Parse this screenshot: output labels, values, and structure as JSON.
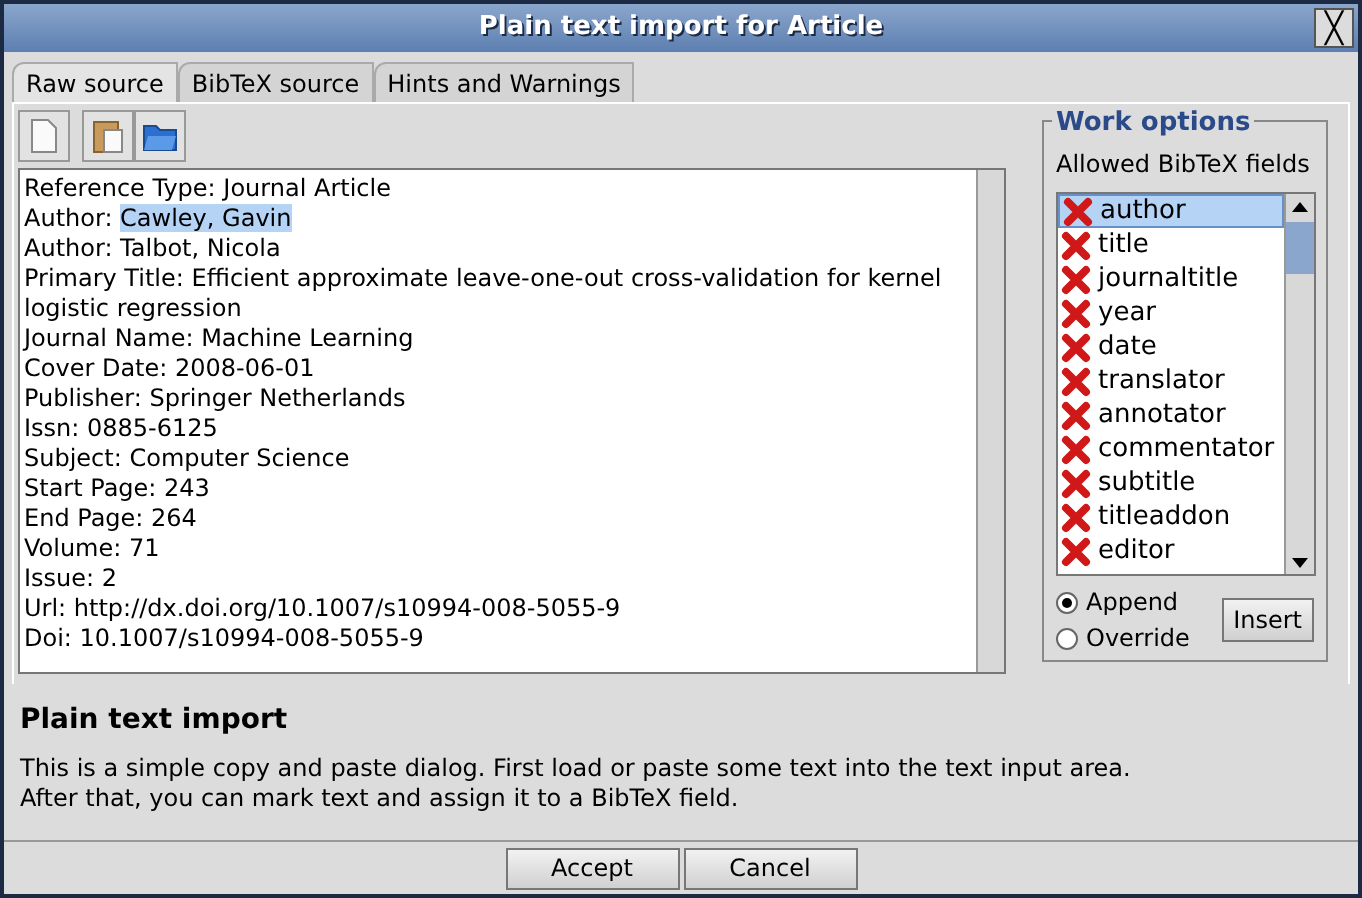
{
  "window": {
    "title": "Plain text import for Article",
    "close": "╳"
  },
  "tabs": [
    {
      "label": "Raw source",
      "selected": true
    },
    {
      "label": "BibTeX source",
      "selected": false
    },
    {
      "label": "Hints and Warnings",
      "selected": false
    }
  ],
  "text_lines": [
    {
      "text": "Reference Type: Journal Article"
    },
    {
      "text": "Author: ",
      "selected_text": "Cawley, Gavin"
    },
    {
      "text": "Author: Talbot, Nicola"
    },
    {
      "text": "Primary Title: Efficient approximate leave-one-out cross-validation for kernel"
    },
    {
      "text": "logistic regression"
    },
    {
      "text": "Journal Name: Machine Learning"
    },
    {
      "text": "Cover Date: 2008-06-01"
    },
    {
      "text": "Publisher: Springer Netherlands"
    },
    {
      "text": "Issn: 0885-6125"
    },
    {
      "text": "Subject: Computer Science"
    },
    {
      "text": "Start Page: 243"
    },
    {
      "text": "End Page: 264"
    },
    {
      "text": "Volume: 71"
    },
    {
      "text": "Issue: 2"
    },
    {
      "text": "Url: http://dx.doi.org/10.1007/s10994-008-5055-9"
    },
    {
      "text": "Doi: 10.1007/s10994-008-5055-9"
    }
  ],
  "work_options": {
    "title": "Work options",
    "fields_label": "Allowed BibTeX fields",
    "fields": [
      {
        "label": "author",
        "selected": true
      },
      {
        "label": "title",
        "selected": false
      },
      {
        "label": "journaltitle",
        "selected": false
      },
      {
        "label": "year",
        "selected": false
      },
      {
        "label": "date",
        "selected": false
      },
      {
        "label": "translator",
        "selected": false
      },
      {
        "label": "annotator",
        "selected": false
      },
      {
        "label": "commentator",
        "selected": false
      },
      {
        "label": "subtitle",
        "selected": false
      },
      {
        "label": "titleaddon",
        "selected": false
      },
      {
        "label": "editor",
        "selected": false
      }
    ],
    "modes": [
      {
        "label": "Append",
        "selected": true
      },
      {
        "label": "Override",
        "selected": false
      }
    ],
    "insert_button": "Insert"
  },
  "help": {
    "title": "Plain text import",
    "lines": [
      "This is a simple copy and paste dialog. First load or paste some text into the text input area.",
      "After that, you can mark text and assign it to a BibTeX field."
    ]
  },
  "buttons": [
    "Accept",
    "Cancel"
  ]
}
